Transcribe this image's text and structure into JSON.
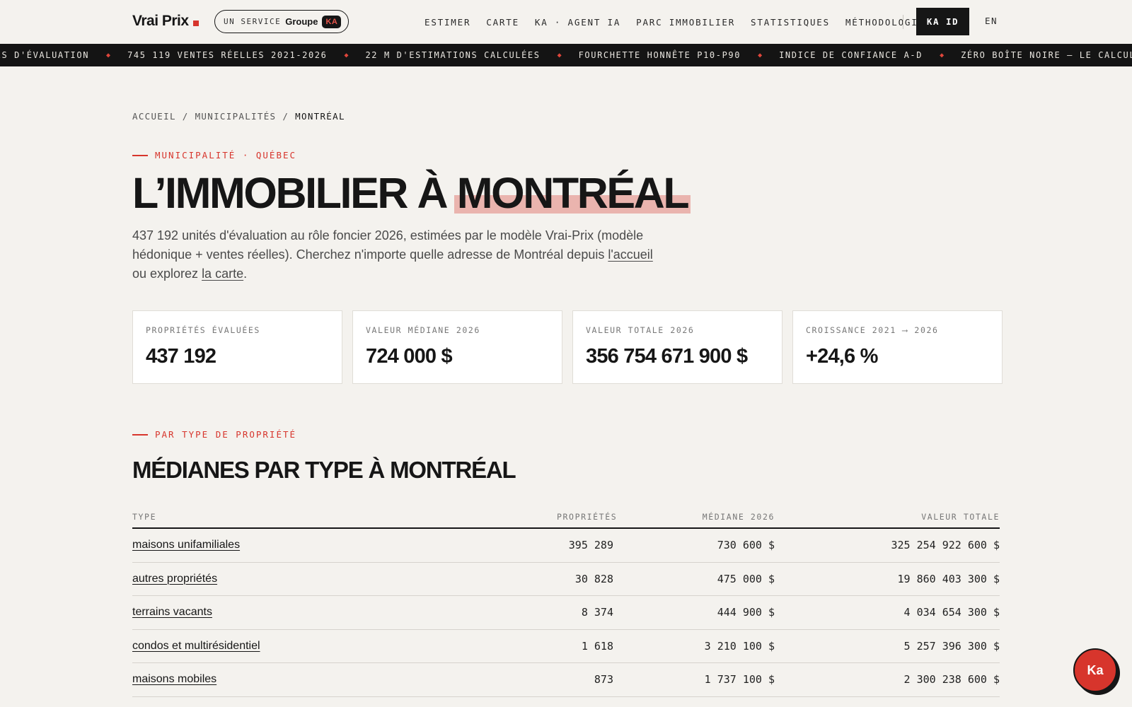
{
  "header": {
    "logo": "Vrai Prix",
    "service_label": "UN SERVICE",
    "service_brand": "Groupe",
    "service_badge": "KA",
    "nav": [
      "ESTIMER",
      "CARTE",
      "KA · AGENT IA",
      "PARC IMMOBILIER",
      "STATISTIQUES",
      "MÉTHODOLOGIE"
    ],
    "ka_id": "KA ID",
    "lang": "EN"
  },
  "ticker": [
    "ITÉS D'ÉVALUATION",
    "745 119 VENTES RÉELLES 2021-2026",
    "22 M D'ESTIMATIONS CALCULÉES",
    "FOURCHETTE HONNÊTE P10-P90",
    "INDICE DE CONFIANCE A-D",
    "ZÉRO BOÎTE NOIRE — LE CALCUL EST MONTRÉ"
  ],
  "breadcrumb": [
    "ACCUEIL",
    "/",
    "MUNICIPALITÉS",
    "/",
    "MONTRÉAL"
  ],
  "hero": {
    "eyebrow": "MUNICIPALITÉ · QUÉBEC",
    "title_prefix": "L’IMMOBILIER À ",
    "title_highlight": "MONTRÉAL",
    "intro_text": "437 192 unités d'évaluation au rôle foncier 2026, estimées par le modèle Vrai-Prix (modèle hédonique + ventes réelles). Cherchez n'importe quelle adresse de Montréal depuis ",
    "intro_link1": "l'accueil",
    "intro_mid": " ou explorez ",
    "intro_link2": "la carte",
    "intro_end": "."
  },
  "stats": [
    {
      "label": "PROPRIÉTÉS ÉVALUÉES",
      "value": "437 192"
    },
    {
      "label": "VALEUR MÉDIANE 2026",
      "value": "724 000 $"
    },
    {
      "label": "VALEUR TOTALE 2026",
      "value": "356 754 671 900 $"
    },
    {
      "label": "CROISSANCE 2021 ⟶ 2026",
      "value": "+24,6 %"
    }
  ],
  "section": {
    "eyebrow": "PAR TYPE DE PROPRIÉTÉ",
    "title": "MÉDIANES PAR TYPE À MONTRÉAL"
  },
  "table": {
    "headers": [
      "TYPE",
      "PROPRIÉTÉS",
      "MÉDIANE 2026",
      "VALEUR TOTALE"
    ],
    "rows": [
      {
        "type": "maisons unifamiliales",
        "count": "395 289",
        "median": "730 600 $",
        "total": "325 254 922 600 $"
      },
      {
        "type": "autres propriétés",
        "count": "30 828",
        "median": "475 000 $",
        "total": "19 860 403 300 $"
      },
      {
        "type": "terrains vacants",
        "count": "8 374",
        "median": "444 900 $",
        "total": "4 034 654 300 $"
      },
      {
        "type": "condos et multirésidentiel",
        "count": "1 618",
        "median": "3 210 100 $",
        "total": "5 257 396 300 $"
      },
      {
        "type": "maisons mobiles",
        "count": "873",
        "median": "1 737 100 $",
        "total": "2 300 238 600 $"
      }
    ]
  },
  "fab_label": "Ka"
}
